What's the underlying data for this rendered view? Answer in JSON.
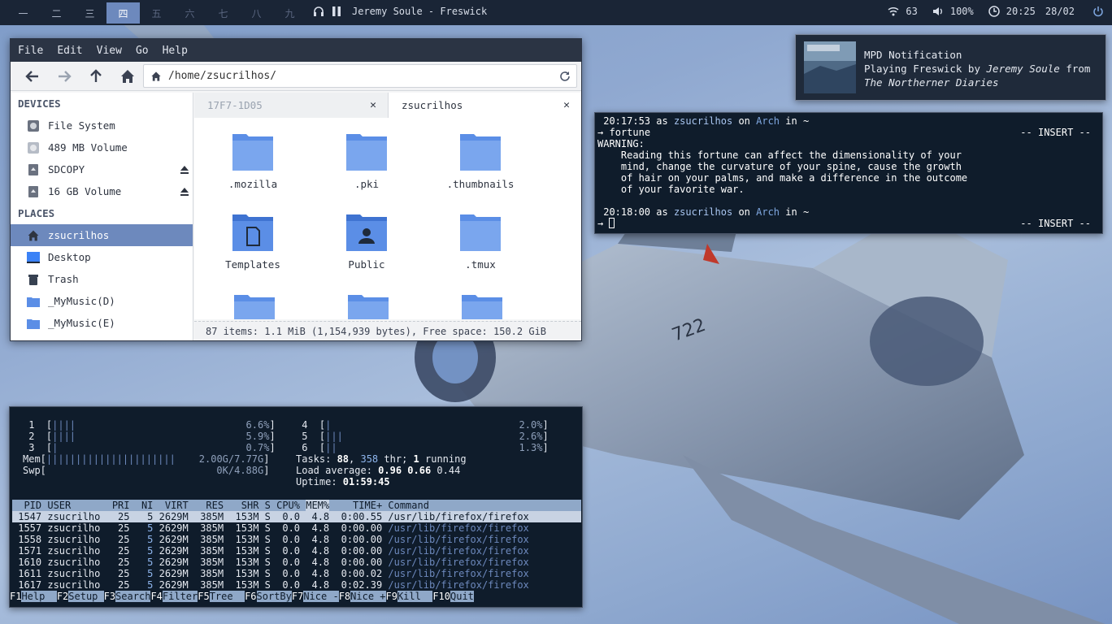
{
  "colors": {
    "accent": "#6d89bd",
    "bar_bg": "#1a2536",
    "terminal_bg": "#0f1c2b",
    "file_bg": "#f5f6f7"
  },
  "topbar": {
    "workspaces": [
      "一",
      "二",
      "三",
      "四",
      "五",
      "六",
      "七",
      "八",
      "九"
    ],
    "active_workspace_index": 3,
    "now_playing": "Jeremy Soule - Freswick",
    "wifi": "63",
    "volume": "100%",
    "time": "20:25",
    "date": "28/02",
    "icons": [
      "headphones-icon",
      "pause-icon",
      "wifi-icon",
      "volume-icon",
      "clock-icon",
      "power-icon"
    ]
  },
  "file_manager": {
    "menu": [
      "File",
      "Edit",
      "View",
      "Go",
      "Help"
    ],
    "location": "/home/zsucrilhos/",
    "sidebar": {
      "devices_heading": "DEVICES",
      "devices": [
        "File System",
        "489 MB Volume",
        "SDCOPY",
        "16 GB Volume"
      ],
      "places_heading": "PLACES",
      "places": [
        "zsucrilhos",
        "Desktop",
        "Trash",
        "_MyMusic(D)",
        "_MyMusic(E)"
      ]
    },
    "tabs": [
      "17F7-1D05",
      "zsucrilhos"
    ],
    "files": [
      ".mozilla",
      ".pki",
      ".thumbnails",
      "Templates",
      "Public",
      ".tmux"
    ],
    "status": "87 items: 1.1 MiB (1,154,939 bytes), Free space: 150.2 GiB"
  },
  "notification": {
    "title": "MPD Notification",
    "line1_prefix": "Playing Freswick by ",
    "artist": "Jeremy Soule",
    "line1_suffix": " from",
    "album": "The Northerner Diaries"
  },
  "terminal": {
    "prompt1_time": "20:17:53",
    "prompt_as": "as",
    "user": "zsucrilhos",
    "prompt_on": "on",
    "host": "Arch",
    "prompt_in": "in",
    "dir": "~",
    "arrow": "→",
    "command": "fortune",
    "mode": "-- INSERT --",
    "output": [
      "WARNING:",
      "    Reading this fortune can affect the dimensionality of your",
      "    mind, change the curvature of your spine, cause the growth",
      "    of hair on your palms, and make a difference in the outcome",
      "    of your favorite war."
    ],
    "prompt2_time": "20:18:00"
  },
  "htop": {
    "cpus": [
      {
        "id": "1",
        "bar": "||||",
        "pct": "6.6%"
      },
      {
        "id": "2",
        "bar": "||||",
        "pct": "5.9%"
      },
      {
        "id": "3",
        "bar": "|",
        "pct": "0.7%"
      },
      {
        "id": "4",
        "bar": "|",
        "pct": "2.0%"
      },
      {
        "id": "5",
        "bar": "|||",
        "pct": "2.6%"
      },
      {
        "id": "6",
        "bar": "||",
        "pct": "1.3%"
      }
    ],
    "mem_label": "Mem",
    "mem_bar": "||||||||||||||||||||||",
    "mem_value": "2.00G/7.77G",
    "swp_label": "Swp",
    "swp_value": "0K/4.88G",
    "tasks_label": "Tasks:",
    "tasks": "88",
    "threads": "358",
    "threads_label": "thr;",
    "running": "1",
    "running_label": "running",
    "load_label": "Load average:",
    "load1": "0.96",
    "load5": "0.66",
    "load15": "0.44",
    "uptime_label": "Uptime:",
    "uptime": "01:59:45",
    "columns": [
      "PID",
      "USER",
      "PRI",
      "NI",
      "VIRT",
      "RES",
      "SHR",
      "S",
      "CPU%",
      "MEM%",
      "TIME+",
      "Command"
    ],
    "processes": [
      {
        "pid": "1547",
        "user": "zsucrilho",
        "pri": "25",
        "ni": "5",
        "virt": "2629M",
        "res": "385M",
        "shr": "153M",
        "s": "S",
        "cpu": "0.0",
        "mem": "4.8",
        "time": "0:00.55",
        "cmd": "/usr/lib/firefox/firefox"
      },
      {
        "pid": "1557",
        "user": "zsucrilho",
        "pri": "25",
        "ni": "5",
        "virt": "2629M",
        "res": "385M",
        "shr": "153M",
        "s": "S",
        "cpu": "0.0",
        "mem": "4.8",
        "time": "0:00.00",
        "cmd": "/usr/lib/firefox/firefox"
      },
      {
        "pid": "1558",
        "user": "zsucrilho",
        "pri": "25",
        "ni": "5",
        "virt": "2629M",
        "res": "385M",
        "shr": "153M",
        "s": "S",
        "cpu": "0.0",
        "mem": "4.8",
        "time": "0:00.00",
        "cmd": "/usr/lib/firefox/firefox"
      },
      {
        "pid": "1571",
        "user": "zsucrilho",
        "pri": "25",
        "ni": "5",
        "virt": "2629M",
        "res": "385M",
        "shr": "153M",
        "s": "S",
        "cpu": "0.0",
        "mem": "4.8",
        "time": "0:00.00",
        "cmd": "/usr/lib/firefox/firefox"
      },
      {
        "pid": "1610",
        "user": "zsucrilho",
        "pri": "25",
        "ni": "5",
        "virt": "2629M",
        "res": "385M",
        "shr": "153M",
        "s": "S",
        "cpu": "0.0",
        "mem": "4.8",
        "time": "0:00.00",
        "cmd": "/usr/lib/firefox/firefox"
      },
      {
        "pid": "1611",
        "user": "zsucrilho",
        "pri": "25",
        "ni": "5",
        "virt": "2629M",
        "res": "385M",
        "shr": "153M",
        "s": "S",
        "cpu": "0.0",
        "mem": "4.8",
        "time": "0:00.02",
        "cmd": "/usr/lib/firefox/firefox"
      },
      {
        "pid": "1617",
        "user": "zsucrilho",
        "pri": "25",
        "ni": "5",
        "virt": "2629M",
        "res": "385M",
        "shr": "153M",
        "s": "S",
        "cpu": "0.0",
        "mem": "4.8",
        "time": "0:02.39",
        "cmd": "/usr/lib/firefox/firefox"
      }
    ],
    "fkeys": [
      {
        "key": "F1",
        "label": "Help  "
      },
      {
        "key": "F2",
        "label": "Setup "
      },
      {
        "key": "F3",
        "label": "Search"
      },
      {
        "key": "F4",
        "label": "Filter"
      },
      {
        "key": "F5",
        "label": "Tree  "
      },
      {
        "key": "F6",
        "label": "SortBy"
      },
      {
        "key": "F7",
        "label": "Nice -"
      },
      {
        "key": "F8",
        "label": "Nice +"
      },
      {
        "key": "F9",
        "label": "Kill  "
      },
      {
        "key": "F10",
        "label": "Quit"
      }
    ]
  }
}
